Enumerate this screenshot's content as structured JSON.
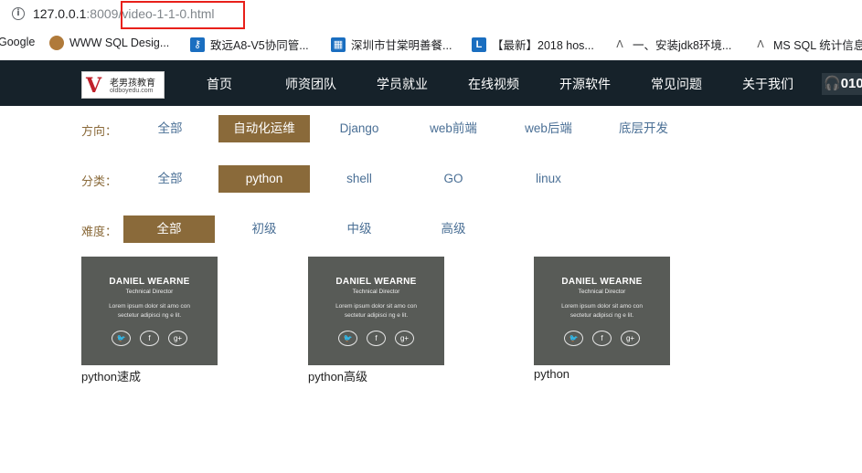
{
  "browser": {
    "url_host": "127.0.0.1",
    "url_port": ":8009",
    "url_path": "/video-1-1-0.html",
    "bookmarks": [
      {
        "label": "Google",
        "icon": "google-icon"
      },
      {
        "label": "WWW SQL Desig...",
        "icon": "avatar-icon"
      },
      {
        "label": "致远A8-V5协同管...",
        "icon": "key-icon"
      },
      {
        "label": "深圳市甘棠明善餐...",
        "icon": "grid-icon"
      },
      {
        "label": "【最新】2018 hos...",
        "icon": "l-icon"
      },
      {
        "label": "一、安装jdk8环境...",
        "icon": "lambda-icon"
      },
      {
        "label": "MS SQL 统计信息",
        "icon": "lambda-icon"
      }
    ]
  },
  "site": {
    "logo_v": "V",
    "logo_name": "老男孩教育",
    "logo_domain": "oldboyedu.com",
    "nav": [
      "首页",
      "师资团队",
      "学员就业",
      "在线视频",
      "开源软件",
      "常见问题",
      "关于我们"
    ],
    "phone": "010"
  },
  "filters": {
    "direction": {
      "label": "方向：",
      "options": [
        "全部",
        "自动化运维",
        "Django",
        "web前端",
        "web后端",
        "底层开发"
      ],
      "active": "自动化运维"
    },
    "category": {
      "label": "分类：",
      "options": [
        "全部",
        "python",
        "shell",
        "GO",
        "linux"
      ],
      "active": "python"
    },
    "level": {
      "label": "难度：",
      "options": [
        "全部",
        "初级",
        "中级",
        "高级"
      ],
      "active": "全部"
    }
  },
  "videos": [
    {
      "title": "python速成",
      "thumb_name": "DANIEL WEARNE",
      "thumb_role": "Technical Director",
      "thumb_text_1": "Lorem ipsum dolor sit amo con",
      "thumb_text_2": "sectetur adipisci ng e lit."
    },
    {
      "title": "python高级",
      "thumb_name": "DANIEL WEARNE",
      "thumb_role": "Technical Director",
      "thumb_text_1": "Lorem ipsum dolor sit amo con",
      "thumb_text_2": "sectetur adipisci ng e lit."
    },
    {
      "title": "python",
      "thumb_name": "DANIEL WEARNE",
      "thumb_role": "Technical Director",
      "thumb_text_1": "Lorem ipsum dolor sit amo con",
      "thumb_text_2": "sectetur adipisci ng e lit."
    }
  ],
  "colors": {
    "nav_bg": "#16222a",
    "accent": "#8a6a3a",
    "link": "#4a6f95",
    "highlight": "#e8201a"
  }
}
